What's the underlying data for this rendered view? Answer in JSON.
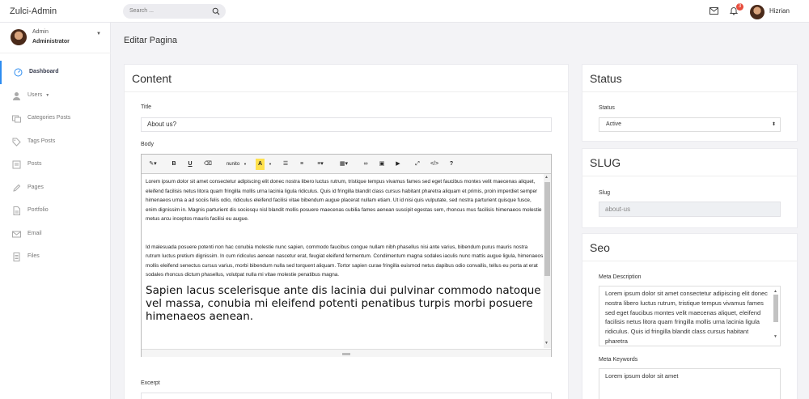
{
  "app": {
    "title": "Zulci-Admin"
  },
  "topbar": {
    "search_placeholder": "Search ...",
    "notification_count": "3",
    "username": "Hizrian",
    "icons": {
      "search": "search-icon",
      "mail": "mail-icon",
      "bell": "bell-icon"
    }
  },
  "sidebar": {
    "user_name": "Admin",
    "user_role": "Administrator",
    "items": [
      {
        "label": "Dashboard",
        "icon": "dashboard-icon",
        "active": true
      },
      {
        "label": "Users",
        "icon": "user-icon",
        "dropdown": true
      },
      {
        "label": "Categories Posts",
        "icon": "categories-icon"
      },
      {
        "label": "Tags Posts",
        "icon": "tag-icon"
      },
      {
        "label": "Posts",
        "icon": "posts-icon"
      },
      {
        "label": "Pages",
        "icon": "pencil-icon"
      },
      {
        "label": "Portfolio",
        "icon": "file-icon"
      },
      {
        "label": "Email",
        "icon": "mail-icon"
      },
      {
        "label": "Files",
        "icon": "files-icon"
      }
    ]
  },
  "page": {
    "title": "Editar Pagina"
  },
  "content": {
    "heading": "Content",
    "title_label": "Title",
    "title_value": "About us?",
    "body_label": "Body",
    "font_name": "nunito",
    "paragraph1": "Lorem ipsum dolor sit amet consectetur adipiscing elit donec nostra libero luctus rutrum, tristique tempus vivamus fames sed eget faucibus montes velit maecenas aliquet, eleifend facilisis netus litora quam fringilla mollis urna lacinia ligula ridiculus. Quis id fringilla blandit class cursus habitant pharetra aliquam et primis, proin imperdiet semper himenaeos urna a ad sociis felis odio, ridiculus eleifend facilisi vitae bibendum augue placerat nullam etiam. Ut id nisi quis vulputate, sed nostra parturient quisque fusce, enim dignissim in. Magnis parturient dis sociosqu nisl blandit mollis posuere maecenas cubilia fames aenean suscipit egestas sem, rhoncus mus facilisis himenaeos molestie metus arcu inceptos mauris facilisi eu augue.",
    "paragraph2": "Id malesuada posuere potenti non hac conubia molestie nunc sapien, commodo faucibus congue nullam nibh phasellus nisi ante varius, bibendum purus mauris nostra rutrum luctus pretium dignissim. In cum ridiculus aenean nascetur erat, feugiat eleifend fermentum. Condimentum magna sodales iaculis nunc mattis augue ligula, himenaeos mollis eleifend senectus cursus varius, morbi bibendum nulla sed torquent aliquam. Tortor sapien curae fringilla euismod netus dapibus odio convallis, tellus eu porta at erat sodales rhoncus dictum phasellus, volutpat nulla mi vitae molestie penatibus magna.",
    "heading_text": "Sapien lacus scelerisque ante dis lacinia dui pulvinar commodo natoque vel massa, conubia mi eleifend potenti penatibus turpis morbi posuere himenaeos aenean.",
    "excerpt_label": "Excerpt"
  },
  "status": {
    "heading": "Status",
    "label": "Status",
    "value": "Active"
  },
  "slug": {
    "heading": "SLUG",
    "label": "Slug",
    "value": "about-us"
  },
  "seo": {
    "heading": "Seo",
    "meta_description_label": "Meta Description",
    "meta_description": "Lorem ipsum dolor sit amet consectetur adipiscing elit donec nostra libero luctus rutrum, tristique tempus vivamus fames sed eget faucibus montes velit maecenas aliquet, eleifend facilisis netus litora quam fringilla mollis urna lacinia ligula ridiculus. Quis id fringilla blandit class cursus habitant pharetra",
    "meta_keywords_label": "Meta Keywords",
    "meta_keywords": "Lorem ipsum dolor sit amet"
  },
  "colors": {
    "accent": "#2d8cf0",
    "badge": "#e74c3c",
    "highlight": "#ffe14d"
  }
}
